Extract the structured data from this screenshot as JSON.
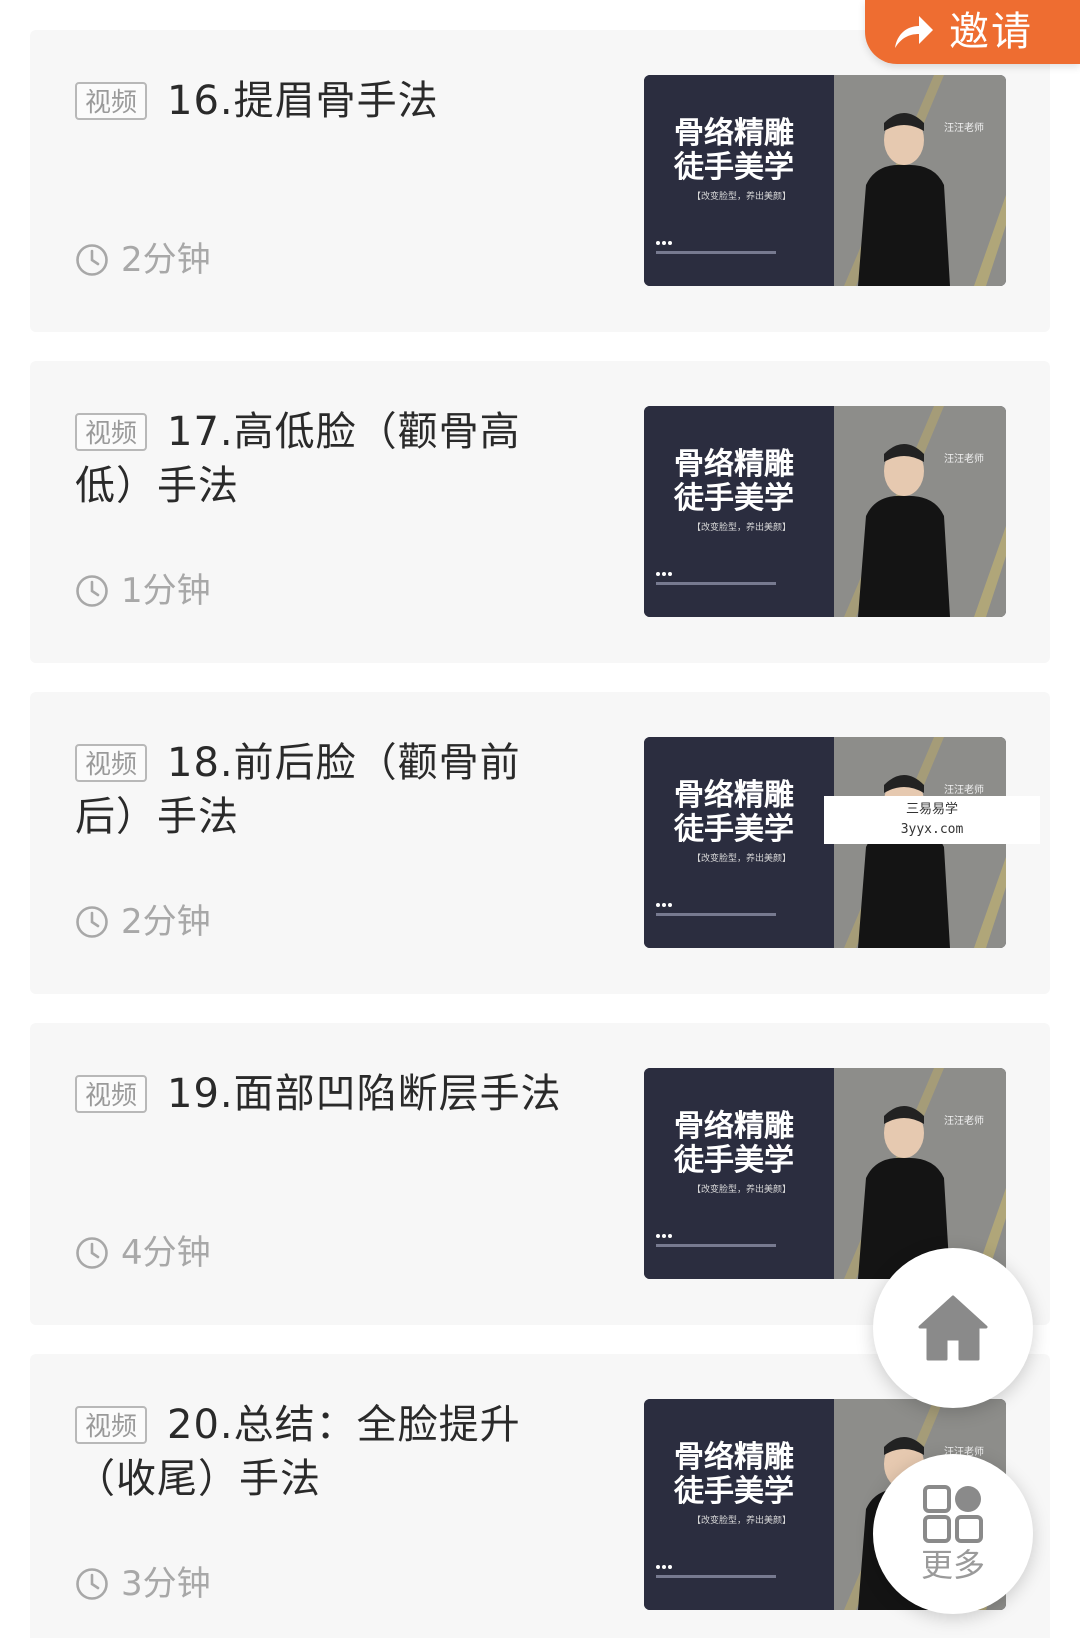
{
  "header": {
    "invite_label": "邀请"
  },
  "lessons": [
    {
      "tag": "视频",
      "title": "16.提眉骨手法",
      "duration": "2分钟"
    },
    {
      "tag": "视频",
      "title": "17.高低脸（颧骨高低）手法",
      "duration": "1分钟"
    },
    {
      "tag": "视频",
      "title": "18.前后脸（颧骨前后）手法",
      "duration": "2分钟"
    },
    {
      "tag": "视频",
      "title": "19.面部凹陷断层手法",
      "duration": "4分钟"
    },
    {
      "tag": "视频",
      "title": "20.总结：全脸提升（收尾）手法",
      "duration": "3分钟"
    }
  ],
  "thumbnail": {
    "headline_line1": "骨络精雕",
    "headline_line2": "徒手美学",
    "subline": "【改变脸型，养出美颜】",
    "teacher_label": "汪汪老师"
  },
  "watermark": {
    "line1": "三易易学",
    "line2": "3yyx.com"
  },
  "floating": {
    "home_icon": "home-icon",
    "more_label": "更多"
  },
  "colors": {
    "accent": "#ee6d31",
    "card_bg": "#f7f7f7",
    "thumb_dark": "#2b2d3f"
  }
}
